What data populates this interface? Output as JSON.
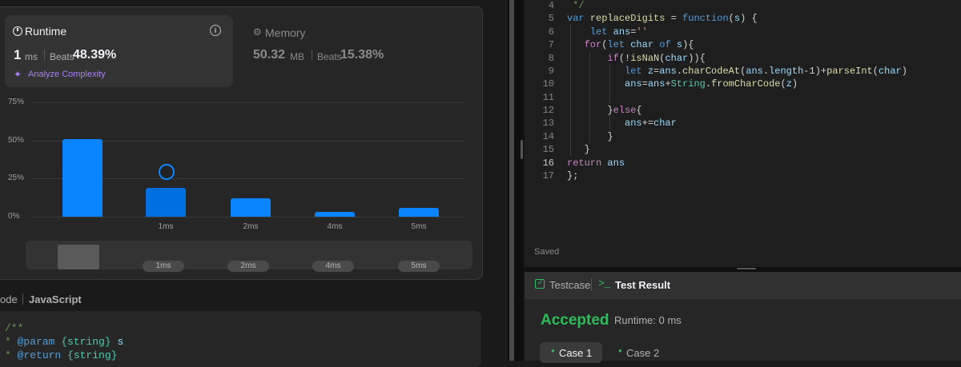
{
  "runtime": {
    "label": "Runtime",
    "value": "1",
    "unit": "ms",
    "beats_label": "Beats",
    "beats_value": "48.39%",
    "analyze": "Analyze Complexity"
  },
  "memory": {
    "label": "Memory",
    "value": "50.32",
    "unit": "MB",
    "beats_label": "Beats",
    "beats_value": "15.38%"
  },
  "chart_data": {
    "type": "bar",
    "categories": [
      "",
      "1ms",
      "2ms",
      "4ms",
      "5ms"
    ],
    "values": [
      51,
      19,
      12,
      3,
      6
    ],
    "ylim": [
      0,
      75
    ],
    "yticks": [
      "75%",
      "50%",
      "25%",
      "0%"
    ],
    "highlight_index": 1,
    "grid": true
  },
  "mini_labels": [
    "1ms",
    "2ms",
    "4ms",
    "5ms"
  ],
  "code_section": {
    "tab_prev": "ode",
    "language": "JavaScript",
    "lines": [
      "/**",
      " * @param {string} s",
      " * @return {string}"
    ]
  },
  "editor": {
    "line_numbers": [
      "4",
      "5",
      "6",
      "7",
      "8",
      "9",
      "10",
      "11",
      "12",
      "13",
      "14",
      "15",
      "16",
      "17"
    ],
    "status": "Saved"
  },
  "bottom": {
    "tab_testcase": "Testcase",
    "tab_result": "Test Result",
    "verdict": "Accepted",
    "runtime_text": "Runtime: 0 ms",
    "cases": [
      "Case 1",
      "Case 2"
    ]
  },
  "colors": {
    "accent_blue": "#0a84ff",
    "accepted_green": "#2cbb5d",
    "analyze_purple": "#a97ff7"
  }
}
